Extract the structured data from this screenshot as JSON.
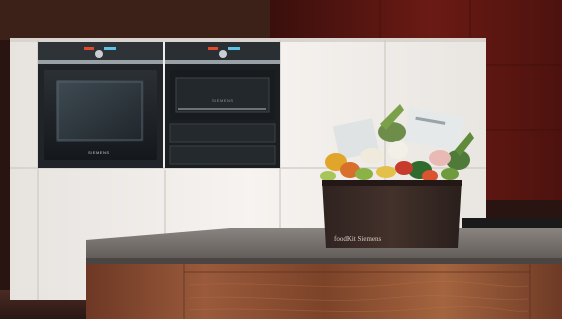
{
  "scene": {
    "oven_left": {
      "brand": "SIEMENS"
    },
    "oven_right": {
      "brand": "SIEMENS"
    },
    "box": {
      "label": "foodKit Siemens"
    }
  },
  "colors": {
    "wall": "#5a1712",
    "cabinet": "#f1eeea",
    "oven_glass": "#1f2327",
    "counter_top": "#6f6a66",
    "wood": "#8a4e33",
    "box": "#3b2a25"
  }
}
